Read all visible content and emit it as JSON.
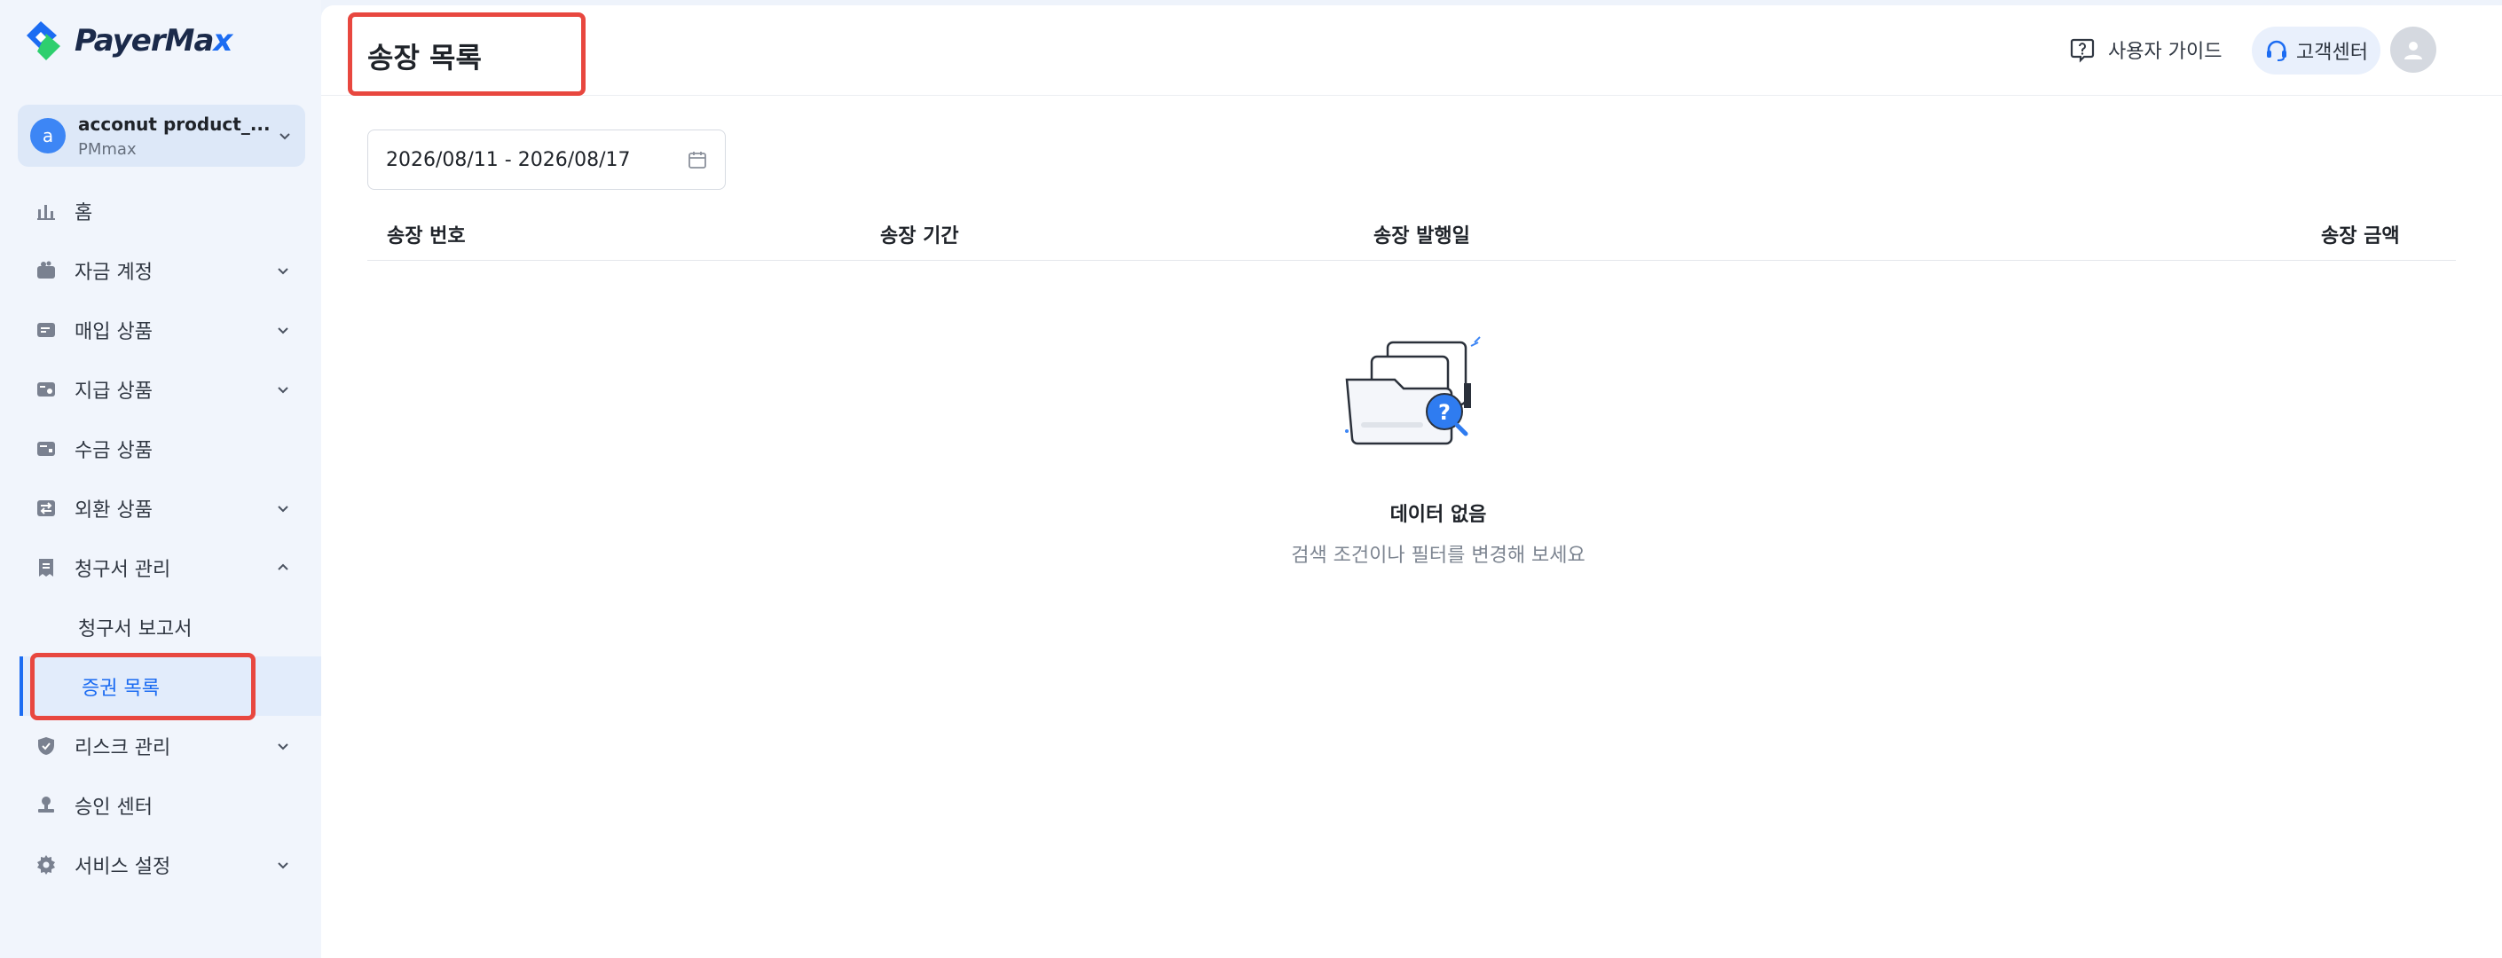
{
  "brand": {
    "name_main": "PayerMa",
    "name_accent": "x",
    "accent_color": "#1c6cf2"
  },
  "account": {
    "initial": "a",
    "name": "acconut product_...",
    "sub": "PMmax"
  },
  "nav": {
    "home": "홈",
    "fund_account": "자금 계정",
    "acquiring": "매입 상품",
    "payout": "지급 상품",
    "collection": "수금 상품",
    "fx": "외환 상품",
    "invoice_mgmt": "청구서 관리",
    "invoice_report": "청구서 보고서",
    "securities_list": "증권 목록",
    "risk_mgmt": "리스크 관리",
    "approval_center": "승인 센터",
    "service_settings": "서비스 설정"
  },
  "header": {
    "title": "송장 목록",
    "guide_label": "사용자 가이드",
    "support_label": "고객센터"
  },
  "filter": {
    "date_range": "2026/08/11 - 2026/08/17"
  },
  "table": {
    "columns": [
      "송장 번호",
      "송장 기간",
      "송장 발행일",
      "송장 금액"
    ]
  },
  "empty": {
    "title": "데이터 없음",
    "hint": "검색 조건이나 필터를 변경해 보세요"
  },
  "colors": {
    "highlight": "#e8473f",
    "primary": "#1c6cf2"
  }
}
